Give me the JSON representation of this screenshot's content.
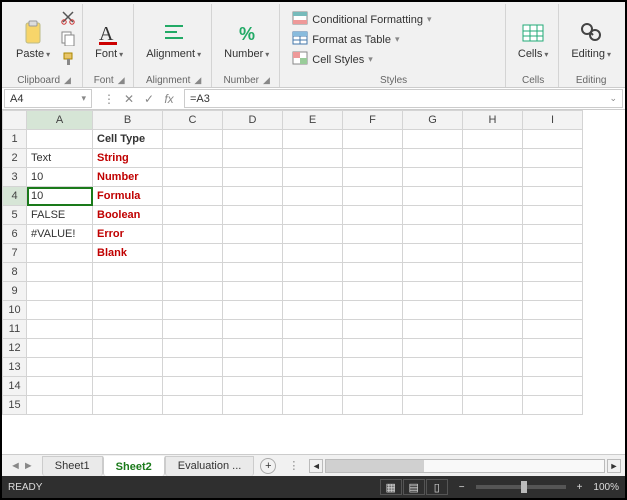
{
  "ribbon": {
    "clipboard": {
      "paste": "Paste",
      "label": "Clipboard"
    },
    "font": {
      "label": "Font",
      "btn": "Font"
    },
    "alignment": {
      "label": "Alignment",
      "btn": "Alignment"
    },
    "number": {
      "label": "Number",
      "btn": "Number"
    },
    "styles": {
      "label": "Styles",
      "cond": "Conditional Formatting",
      "table": "Format as Table",
      "cell": "Cell Styles"
    },
    "cells": {
      "label": "Cells",
      "btn": "Cells"
    },
    "editing": {
      "label": "Editing",
      "btn": "Editing"
    }
  },
  "formula_bar": {
    "name_box": "A4",
    "formula": "=A3"
  },
  "grid": {
    "columns": [
      "A",
      "B",
      "C",
      "D",
      "E",
      "F",
      "G",
      "H",
      "I"
    ],
    "rows": 15,
    "active_cell": {
      "row": 4,
      "col": "A"
    },
    "data": {
      "B1": {
        "v": "Cell Type",
        "cls": "bold"
      },
      "A2": {
        "v": "Text"
      },
      "B2": {
        "v": "String",
        "cls": "red-bold"
      },
      "A3": {
        "v": "10"
      },
      "B3": {
        "v": "Number",
        "cls": "red-bold"
      },
      "A4": {
        "v": "10"
      },
      "B4": {
        "v": "Formula",
        "cls": "red-bold"
      },
      "A5": {
        "v": "FALSE"
      },
      "B5": {
        "v": "Boolean",
        "cls": "red-bold"
      },
      "A6": {
        "v": "#VALUE!"
      },
      "B6": {
        "v": "Error",
        "cls": "red-bold"
      },
      "B7": {
        "v": "Blank",
        "cls": "red-bold"
      }
    }
  },
  "tabs": {
    "sheets": [
      "Sheet1",
      "Sheet2",
      "Evaluation  ..."
    ],
    "active": "Sheet2"
  },
  "status": {
    "mode": "READY",
    "zoom": "100%"
  }
}
